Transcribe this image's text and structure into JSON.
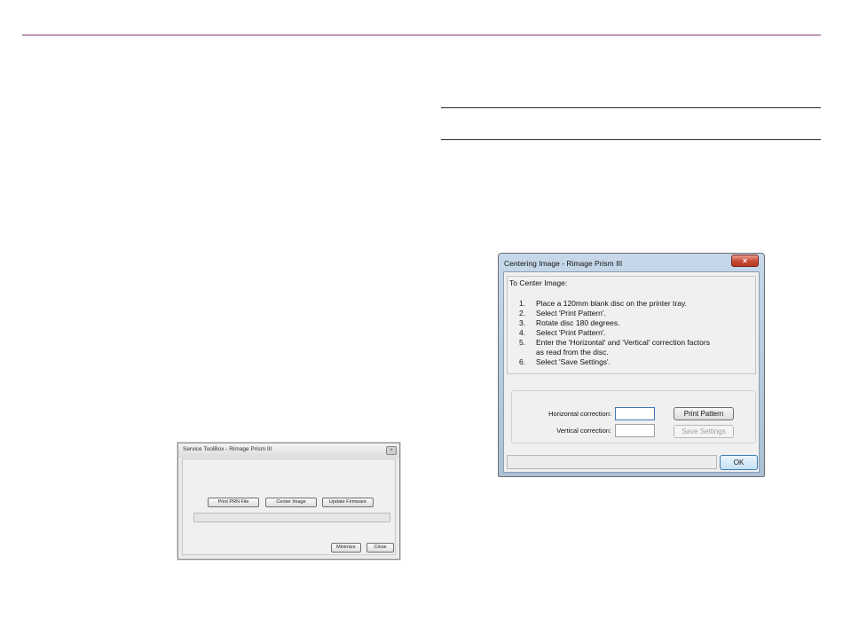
{
  "service_toolbox": {
    "title": "Service ToolBox - Rimage Prism III",
    "close_glyph": "×",
    "buttons": {
      "print_prn": "Print PRN File",
      "center_image": "Center Image",
      "update_firmware": "Update Firmware",
      "minimize": "Minimize",
      "close": "Close"
    }
  },
  "centering_dialog": {
    "title": "Centering Image - Rimage Prism III",
    "close_glyph": "×",
    "heading": "To Center Image:",
    "steps": [
      {
        "num": "1.",
        "text": "Place a 120mm blank disc on the printer tray."
      },
      {
        "num": "2.",
        "text": "Select 'Print Pattern'."
      },
      {
        "num": "3.",
        "text": "Rotate disc 180 degrees."
      },
      {
        "num": "4.",
        "text": "Select 'Print Pattern'."
      },
      {
        "num": "5.",
        "text": "Enter the 'Horizontal' and 'Vertical' correction factors",
        "cont": "as read from the disc."
      },
      {
        "num": "6.",
        "text": "Select 'Save Settings'."
      }
    ],
    "horizontal_label": "Horizontal correction:",
    "vertical_label": "Vertical correction:",
    "horizontal_value": "",
    "vertical_value": "",
    "print_pattern_button": "Print Pattern",
    "save_settings_button": "Save Settings",
    "ok_button": "OK"
  }
}
